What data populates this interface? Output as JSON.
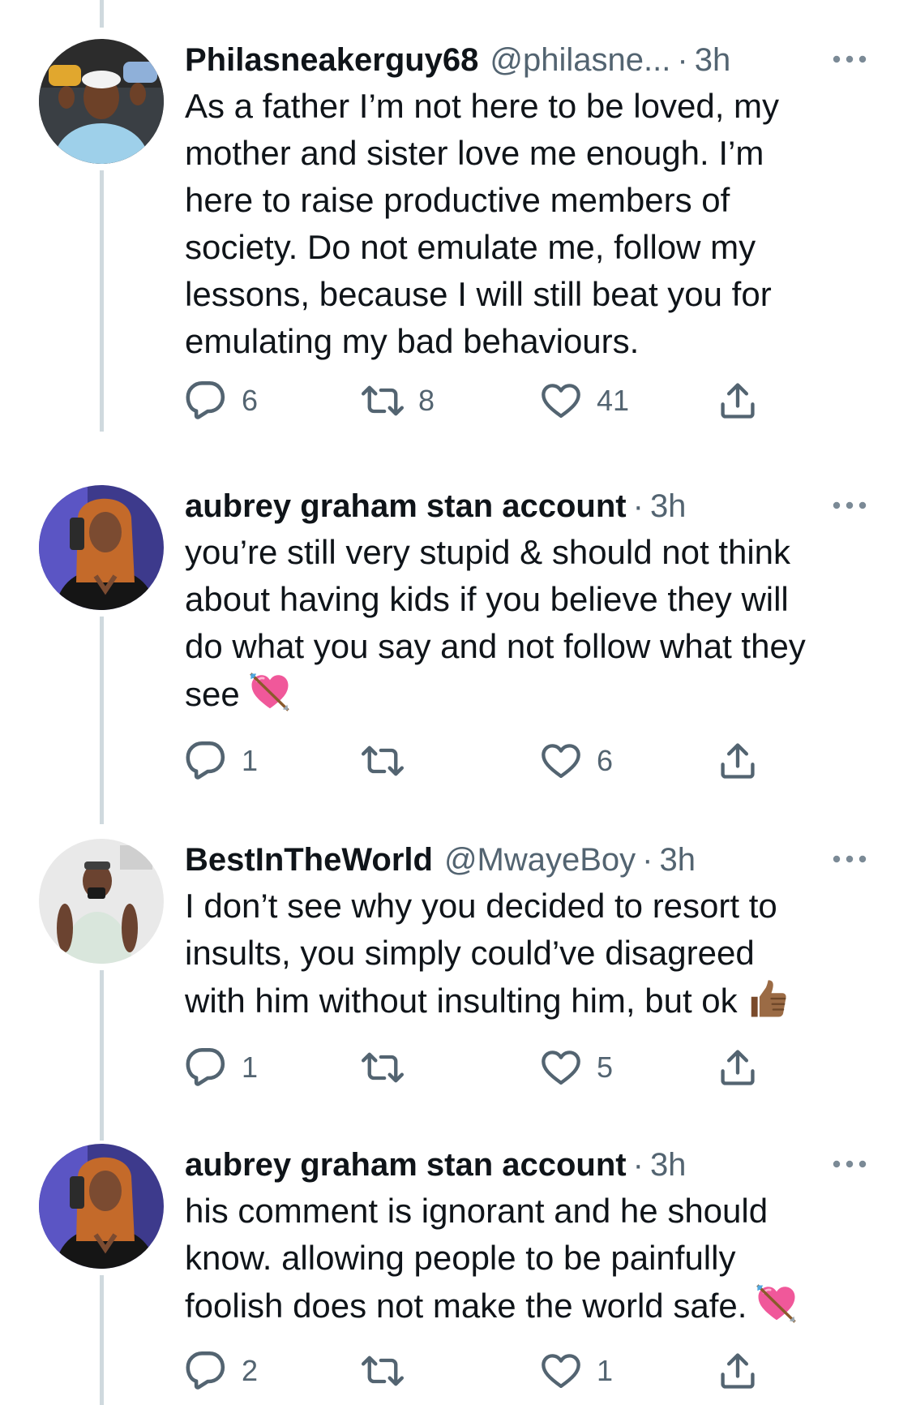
{
  "colors": {
    "text": "#0f1419",
    "secondary": "#536471",
    "connector": "#cfd9de"
  },
  "tweets": [
    {
      "display_name": "Philasneakerguy68",
      "handle": "@philasne...",
      "separator": "·",
      "time": "3h",
      "text_lines": [
        "As a father I’m not here to be loved, my",
        "mother and sister love me enough. I’m",
        "here to raise productive members of",
        "society. Do not emulate me, follow my",
        "lessons, because I will still beat you for",
        "emulating my bad behaviours."
      ],
      "emoji": "",
      "counts": {
        "replies": "6",
        "retweets": "8",
        "likes": "41"
      }
    },
    {
      "display_name": "aubrey graham stan account",
      "handle": "",
      "separator": "·",
      "time": "3h",
      "text_lines": [
        "you’re still very stupid & should not think",
        "about having kids if you believe they will",
        "do what you say and not follow what they",
        "see"
      ],
      "emoji": "heart-with-arrow-icon",
      "counts": {
        "replies": "1",
        "retweets": "",
        "likes": "6"
      }
    },
    {
      "display_name": "BestInTheWorld",
      "handle": "@MwayeBoy",
      "separator": "·",
      "time": "3h",
      "text_lines": [
        "I don’t see why you decided to resort to",
        "insults, you simply could’ve disagreed",
        "with him without insulting him, but ok"
      ],
      "emoji": "thumbs-up-icon",
      "counts": {
        "replies": "1",
        "retweets": "",
        "likes": "5"
      }
    },
    {
      "display_name": "aubrey graham stan account",
      "handle": "",
      "separator": "·",
      "time": "3h",
      "text_lines": [
        "his comment is ignorant and he should",
        "know. allowing people to be painfully",
        "foolish does not make the world safe."
      ],
      "emoji": "heart-with-arrow-icon",
      "counts": {
        "replies": "2",
        "retweets": "",
        "likes": "1"
      }
    }
  ]
}
